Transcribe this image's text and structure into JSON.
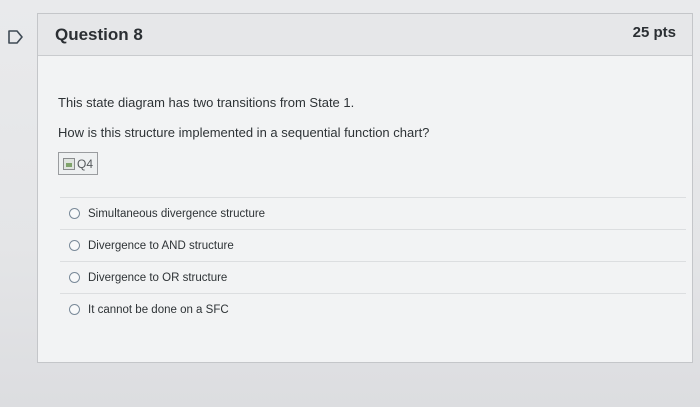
{
  "question": {
    "title": "Question 8",
    "points": "25 pts",
    "text_1": "This state diagram has two transitions from State 1.",
    "text_2": "How is this structure implemented in a sequential function chart?",
    "image_alt": "Q4",
    "answers": [
      {
        "label": "Simultaneous divergence structure"
      },
      {
        "label": "Divergence to AND structure"
      },
      {
        "label": "Divergence to OR structure"
      },
      {
        "label": "It cannot be done on a SFC"
      }
    ]
  },
  "colors": {
    "flag": "#3f4a55",
    "header_bg": "#e6e7e9",
    "card_bg": "#f2f3f4"
  },
  "icons": {
    "flag": "unanswered-flag-icon",
    "broken_image": "broken-image-icon",
    "radio": "radio-empty-icon"
  }
}
